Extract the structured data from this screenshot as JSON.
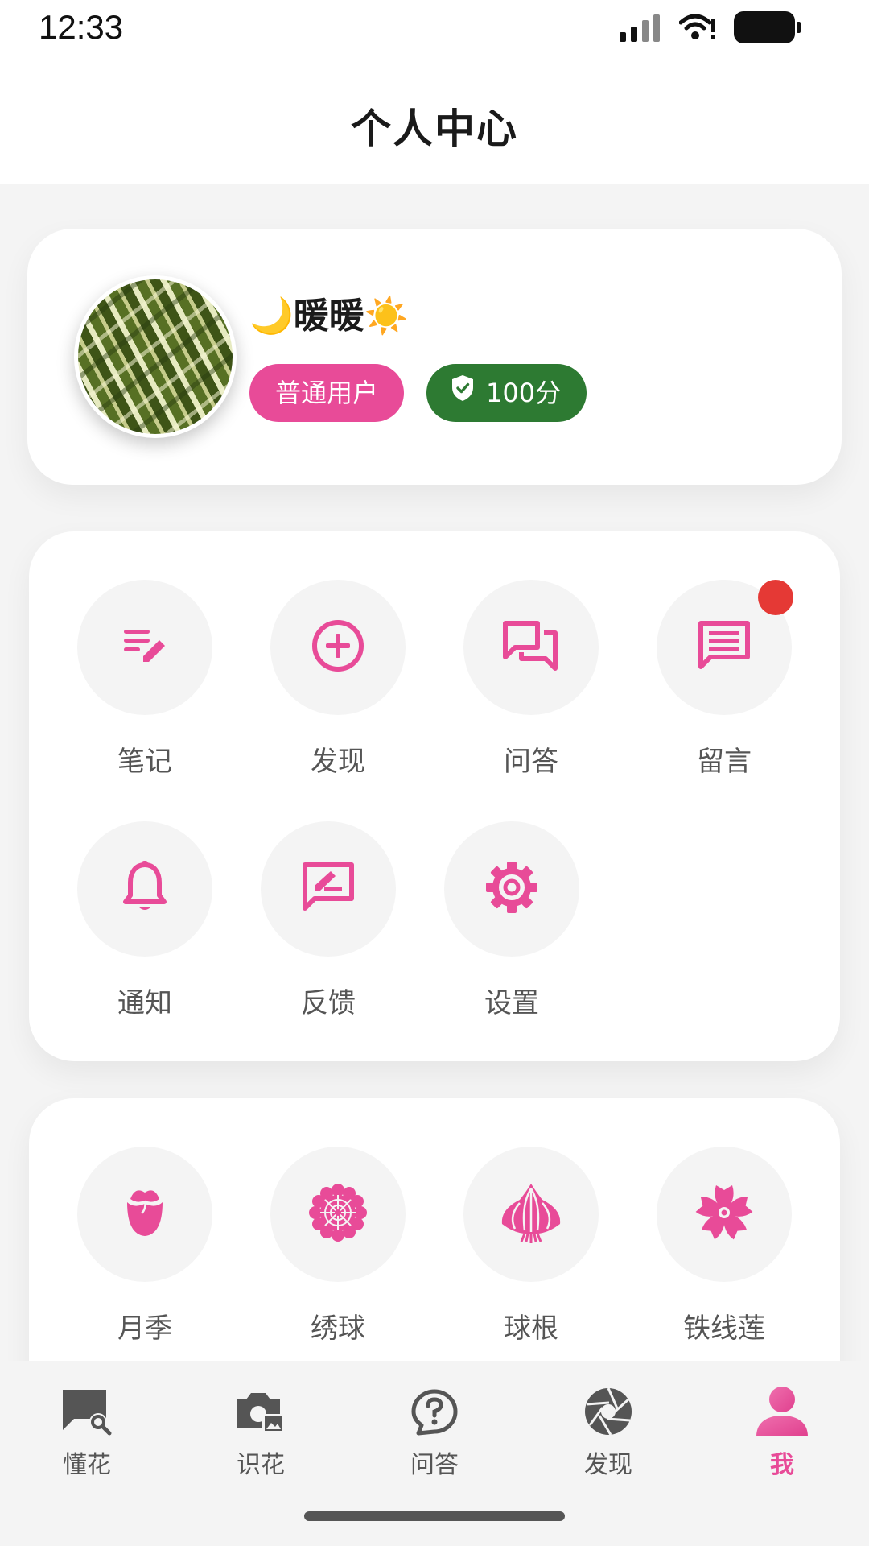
{
  "status_bar": {
    "time": "12:33"
  },
  "header": {
    "title": "个人中心"
  },
  "profile": {
    "name": "🌙暖暖☀️",
    "role": "普通用户",
    "score": "100分"
  },
  "menu": {
    "items": [
      {
        "label": "笔记",
        "icon": "note-edit-icon"
      },
      {
        "label": "发现",
        "icon": "add-circle-icon"
      },
      {
        "label": "问答",
        "icon": "forum-icon"
      },
      {
        "label": "留言",
        "icon": "message-icon",
        "has_unread_dot": true
      },
      {
        "label": "通知",
        "icon": "bell-icon"
      },
      {
        "label": "反馈",
        "icon": "feedback-icon"
      },
      {
        "label": "设置",
        "icon": "gear-icon"
      }
    ]
  },
  "flowers": {
    "items": [
      {
        "label": "月季",
        "icon": "rose-icon"
      },
      {
        "label": "绣球",
        "icon": "hydrangea-icon"
      },
      {
        "label": "球根",
        "icon": "bulb-icon"
      },
      {
        "label": "铁线莲",
        "icon": "clematis-icon"
      }
    ]
  },
  "tabbar": {
    "items": [
      {
        "label": "懂花",
        "icon": "chat-search-icon"
      },
      {
        "label": "识花",
        "icon": "camera-image-icon"
      },
      {
        "label": "问答",
        "icon": "question-bubble-icon"
      },
      {
        "label": "发现",
        "icon": "aperture-icon"
      },
      {
        "label": "我",
        "icon": "person-icon",
        "active": true
      }
    ]
  },
  "colors": {
    "accent": "#e84b98",
    "score_badge": "#2d7a32",
    "unread_dot": "#e53935",
    "background": "#f4f4f4"
  }
}
